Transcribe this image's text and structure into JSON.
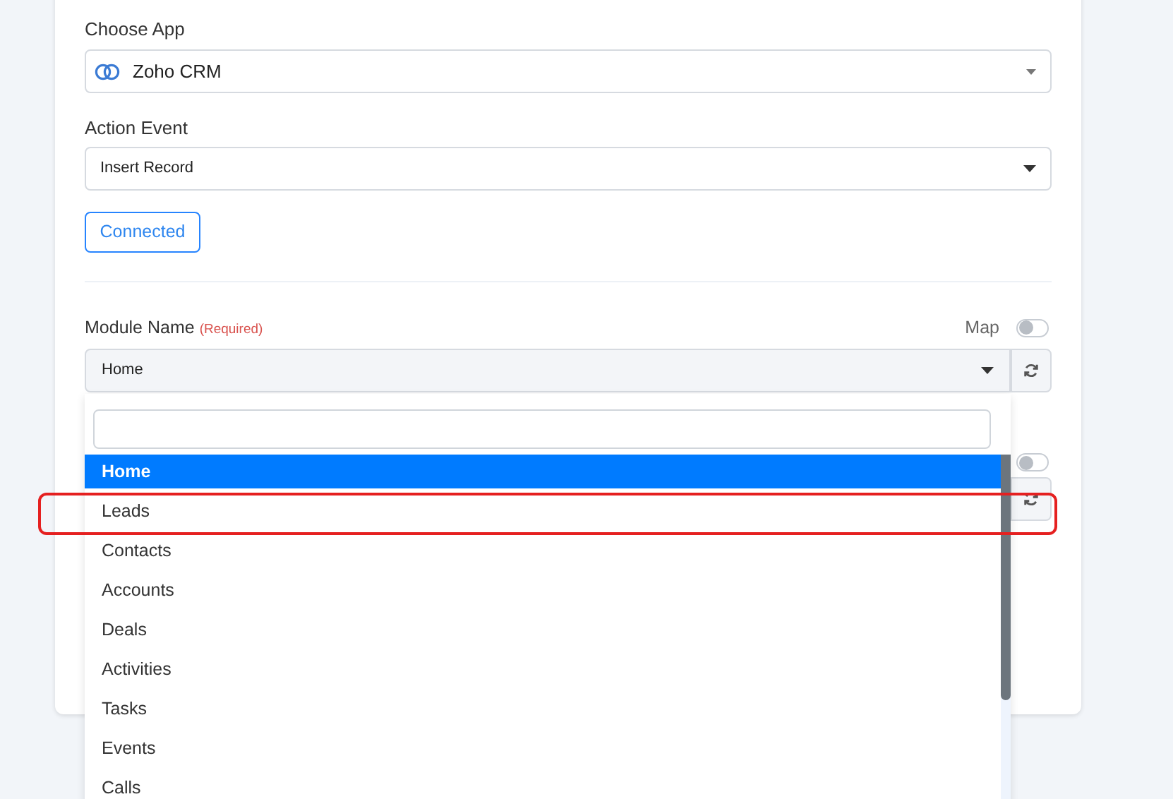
{
  "choose_app": {
    "label": "Choose App",
    "value": "Zoho CRM"
  },
  "action_event": {
    "label": "Action Event",
    "value": "Insert Record"
  },
  "connect_button": "Connected",
  "module_name": {
    "label": "Module Name",
    "required": "(Required)",
    "map_label": "Map",
    "map_on": false,
    "value": "Home"
  },
  "next_field": {
    "map_on": false
  },
  "dropdown": {
    "options": [
      {
        "label": "Home",
        "selected": true,
        "annotated": false
      },
      {
        "label": "Leads",
        "selected": false,
        "annotated": true
      },
      {
        "label": "Contacts",
        "selected": false,
        "annotated": false
      },
      {
        "label": "Accounts",
        "selected": false,
        "annotated": false
      },
      {
        "label": "Deals",
        "selected": false,
        "annotated": false
      },
      {
        "label": "Activities",
        "selected": false,
        "annotated": false
      },
      {
        "label": "Tasks",
        "selected": false,
        "annotated": false
      },
      {
        "label": "Events",
        "selected": false,
        "annotated": false
      },
      {
        "label": "Calls",
        "selected": false,
        "annotated": false
      }
    ]
  }
}
